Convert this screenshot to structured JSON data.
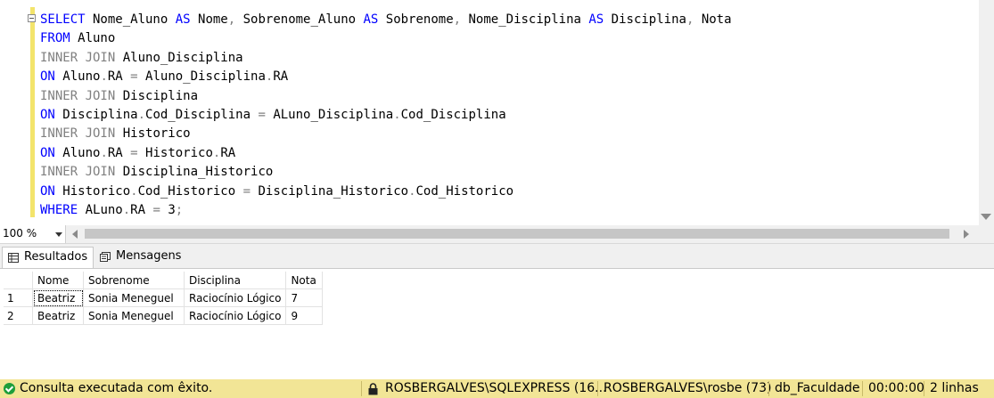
{
  "editor": {
    "lines": [
      [
        {
          "t": "SELECT",
          "c": "kw"
        },
        {
          "t": " Nome_Aluno "
        },
        {
          "t": "AS",
          "c": "kw"
        },
        {
          "t": " Nome"
        },
        {
          "t": ",",
          "c": "gr"
        },
        {
          "t": " Sobrenome_Aluno "
        },
        {
          "t": "AS",
          "c": "kw"
        },
        {
          "t": " Sobrenome"
        },
        {
          "t": ",",
          "c": "gr"
        },
        {
          "t": " Nome_Disciplina "
        },
        {
          "t": "AS",
          "c": "kw"
        },
        {
          "t": " Disciplina"
        },
        {
          "t": ",",
          "c": "gr"
        },
        {
          "t": " Nota"
        }
      ],
      [
        {
          "t": "FROM",
          "c": "kw"
        },
        {
          "t": " Aluno"
        }
      ],
      [
        {
          "t": "INNER JOIN",
          "c": "gr"
        },
        {
          "t": " Aluno_Disciplina"
        }
      ],
      [
        {
          "t": "ON",
          "c": "kw"
        },
        {
          "t": " Aluno"
        },
        {
          "t": ".",
          "c": "gr"
        },
        {
          "t": "RA "
        },
        {
          "t": "=",
          "c": "gr"
        },
        {
          "t": " Aluno_Disciplina"
        },
        {
          "t": ".",
          "c": "gr"
        },
        {
          "t": "RA"
        }
      ],
      [
        {
          "t": "INNER JOIN",
          "c": "gr"
        },
        {
          "t": " Disciplina"
        }
      ],
      [
        {
          "t": "ON",
          "c": "kw"
        },
        {
          "t": " Disciplina"
        },
        {
          "t": ".",
          "c": "gr"
        },
        {
          "t": "Cod_Disciplina "
        },
        {
          "t": "=",
          "c": "gr"
        },
        {
          "t": " ALuno_Disciplina"
        },
        {
          "t": ".",
          "c": "gr"
        },
        {
          "t": "Cod_Disciplina"
        }
      ],
      [
        {
          "t": "INNER JOIN",
          "c": "gr"
        },
        {
          "t": " Historico"
        }
      ],
      [
        {
          "t": "ON",
          "c": "kw"
        },
        {
          "t": " Aluno"
        },
        {
          "t": ".",
          "c": "gr"
        },
        {
          "t": "RA "
        },
        {
          "t": "=",
          "c": "gr"
        },
        {
          "t": " Historico"
        },
        {
          "t": ".",
          "c": "gr"
        },
        {
          "t": "RA"
        }
      ],
      [
        {
          "t": "INNER JOIN",
          "c": "gr"
        },
        {
          "t": " Disciplina_Historico"
        }
      ],
      [
        {
          "t": "ON",
          "c": "kw"
        },
        {
          "t": " Historico"
        },
        {
          "t": ".",
          "c": "gr"
        },
        {
          "t": "Cod_Historico "
        },
        {
          "t": "=",
          "c": "gr"
        },
        {
          "t": " Disciplina_Historico"
        },
        {
          "t": ".",
          "c": "gr"
        },
        {
          "t": "Cod_Historico"
        }
      ],
      [
        {
          "t": "WHERE",
          "c": "kw"
        },
        {
          "t": " ALuno"
        },
        {
          "t": ".",
          "c": "gr"
        },
        {
          "t": "RA "
        },
        {
          "t": "=",
          "c": "gr"
        },
        {
          "t": " 3"
        },
        {
          "t": ";",
          "c": "gr"
        }
      ]
    ]
  },
  "zoom": {
    "value": "100 %"
  },
  "tabs": {
    "results": "Resultados",
    "messages": "Mensagens"
  },
  "grid": {
    "columns": [
      "Nome",
      "Sobrenome",
      "Disciplina",
      "Nota"
    ],
    "rows": [
      {
        "num": "1",
        "cells": [
          "Beatriz",
          "Sonia Meneguel",
          "Raciocínio Lógico",
          "7"
        ]
      },
      {
        "num": "2",
        "cells": [
          "Beatriz",
          "Sonia Meneguel",
          "Raciocínio Lógico",
          "9"
        ]
      }
    ]
  },
  "status": {
    "message": "Consulta executada com êxito.",
    "server": "ROSBERGALVES\\SQLEXPRESS (16...",
    "user": "ROSBERGALVES\\rosbe (73)",
    "database": "db_Faculdade",
    "elapsed": "00:00:00",
    "rows": "2 linhas"
  },
  "colors": {
    "keyword": "#0000ff",
    "operator": "#808080",
    "statusbar": "#f2e596",
    "change_marker": "#f3e46b"
  },
  "icons": [
    "check-circle-icon",
    "lock-icon",
    "grid-icon",
    "messages-icon"
  ]
}
